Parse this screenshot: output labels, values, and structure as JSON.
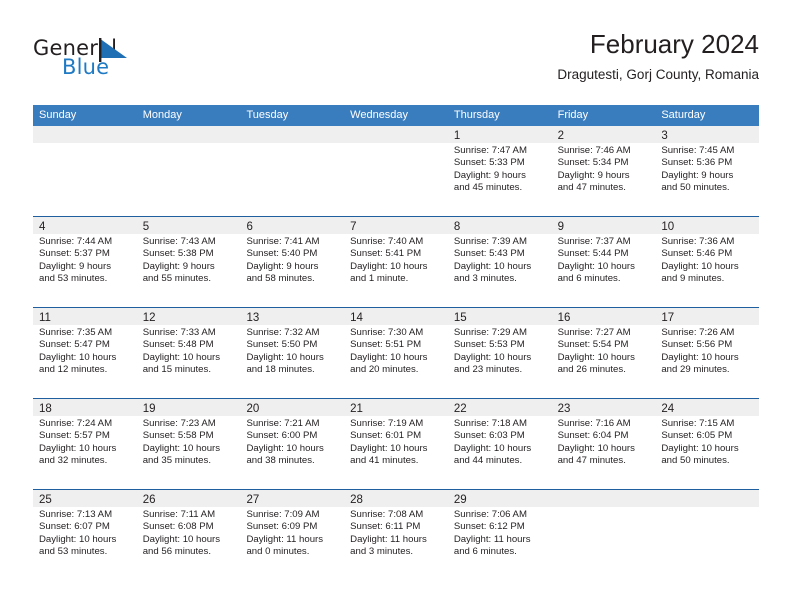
{
  "brand": {
    "word_general": "General",
    "word_blue": "Blue",
    "mark": "blue-flag-triangle"
  },
  "header": {
    "title": "February 2024",
    "location": "Dragutesti, Gorj County, Romania"
  },
  "colors": {
    "header_blue": "#3a7dbf",
    "row_divider_blue": "#1f5fa0",
    "day_band_gray": "#efefef",
    "brand_blue": "#1f7ac4",
    "text": "#231f20"
  },
  "weekdays": [
    "Sunday",
    "Monday",
    "Tuesday",
    "Wednesday",
    "Thursday",
    "Friday",
    "Saturday"
  ],
  "weeks": [
    [
      {
        "day": "",
        "sunrise": "",
        "sunset": "",
        "daylight_1": "",
        "daylight_2": ""
      },
      {
        "day": "",
        "sunrise": "",
        "sunset": "",
        "daylight_1": "",
        "daylight_2": ""
      },
      {
        "day": "",
        "sunrise": "",
        "sunset": "",
        "daylight_1": "",
        "daylight_2": ""
      },
      {
        "day": "",
        "sunrise": "",
        "sunset": "",
        "daylight_1": "",
        "daylight_2": ""
      },
      {
        "day": "1",
        "sunrise": "Sunrise: 7:47 AM",
        "sunset": "Sunset: 5:33 PM",
        "daylight_1": "Daylight: 9 hours",
        "daylight_2": "and 45 minutes."
      },
      {
        "day": "2",
        "sunrise": "Sunrise: 7:46 AM",
        "sunset": "Sunset: 5:34 PM",
        "daylight_1": "Daylight: 9 hours",
        "daylight_2": "and 47 minutes."
      },
      {
        "day": "3",
        "sunrise": "Sunrise: 7:45 AM",
        "sunset": "Sunset: 5:36 PM",
        "daylight_1": "Daylight: 9 hours",
        "daylight_2": "and 50 minutes."
      }
    ],
    [
      {
        "day": "4",
        "sunrise": "Sunrise: 7:44 AM",
        "sunset": "Sunset: 5:37 PM",
        "daylight_1": "Daylight: 9 hours",
        "daylight_2": "and 53 minutes."
      },
      {
        "day": "5",
        "sunrise": "Sunrise: 7:43 AM",
        "sunset": "Sunset: 5:38 PM",
        "daylight_1": "Daylight: 9 hours",
        "daylight_2": "and 55 minutes."
      },
      {
        "day": "6",
        "sunrise": "Sunrise: 7:41 AM",
        "sunset": "Sunset: 5:40 PM",
        "daylight_1": "Daylight: 9 hours",
        "daylight_2": "and 58 minutes."
      },
      {
        "day": "7",
        "sunrise": "Sunrise: 7:40 AM",
        "sunset": "Sunset: 5:41 PM",
        "daylight_1": "Daylight: 10 hours",
        "daylight_2": "and 1 minute."
      },
      {
        "day": "8",
        "sunrise": "Sunrise: 7:39 AM",
        "sunset": "Sunset: 5:43 PM",
        "daylight_1": "Daylight: 10 hours",
        "daylight_2": "and 3 minutes."
      },
      {
        "day": "9",
        "sunrise": "Sunrise: 7:37 AM",
        "sunset": "Sunset: 5:44 PM",
        "daylight_1": "Daylight: 10 hours",
        "daylight_2": "and 6 minutes."
      },
      {
        "day": "10",
        "sunrise": "Sunrise: 7:36 AM",
        "sunset": "Sunset: 5:46 PM",
        "daylight_1": "Daylight: 10 hours",
        "daylight_2": "and 9 minutes."
      }
    ],
    [
      {
        "day": "11",
        "sunrise": "Sunrise: 7:35 AM",
        "sunset": "Sunset: 5:47 PM",
        "daylight_1": "Daylight: 10 hours",
        "daylight_2": "and 12 minutes."
      },
      {
        "day": "12",
        "sunrise": "Sunrise: 7:33 AM",
        "sunset": "Sunset: 5:48 PM",
        "daylight_1": "Daylight: 10 hours",
        "daylight_2": "and 15 minutes."
      },
      {
        "day": "13",
        "sunrise": "Sunrise: 7:32 AM",
        "sunset": "Sunset: 5:50 PM",
        "daylight_1": "Daylight: 10 hours",
        "daylight_2": "and 18 minutes."
      },
      {
        "day": "14",
        "sunrise": "Sunrise: 7:30 AM",
        "sunset": "Sunset: 5:51 PM",
        "daylight_1": "Daylight: 10 hours",
        "daylight_2": "and 20 minutes."
      },
      {
        "day": "15",
        "sunrise": "Sunrise: 7:29 AM",
        "sunset": "Sunset: 5:53 PM",
        "daylight_1": "Daylight: 10 hours",
        "daylight_2": "and 23 minutes."
      },
      {
        "day": "16",
        "sunrise": "Sunrise: 7:27 AM",
        "sunset": "Sunset: 5:54 PM",
        "daylight_1": "Daylight: 10 hours",
        "daylight_2": "and 26 minutes."
      },
      {
        "day": "17",
        "sunrise": "Sunrise: 7:26 AM",
        "sunset": "Sunset: 5:56 PM",
        "daylight_1": "Daylight: 10 hours",
        "daylight_2": "and 29 minutes."
      }
    ],
    [
      {
        "day": "18",
        "sunrise": "Sunrise: 7:24 AM",
        "sunset": "Sunset: 5:57 PM",
        "daylight_1": "Daylight: 10 hours",
        "daylight_2": "and 32 minutes."
      },
      {
        "day": "19",
        "sunrise": "Sunrise: 7:23 AM",
        "sunset": "Sunset: 5:58 PM",
        "daylight_1": "Daylight: 10 hours",
        "daylight_2": "and 35 minutes."
      },
      {
        "day": "20",
        "sunrise": "Sunrise: 7:21 AM",
        "sunset": "Sunset: 6:00 PM",
        "daylight_1": "Daylight: 10 hours",
        "daylight_2": "and 38 minutes."
      },
      {
        "day": "21",
        "sunrise": "Sunrise: 7:19 AM",
        "sunset": "Sunset: 6:01 PM",
        "daylight_1": "Daylight: 10 hours",
        "daylight_2": "and 41 minutes."
      },
      {
        "day": "22",
        "sunrise": "Sunrise: 7:18 AM",
        "sunset": "Sunset: 6:03 PM",
        "daylight_1": "Daylight: 10 hours",
        "daylight_2": "and 44 minutes."
      },
      {
        "day": "23",
        "sunrise": "Sunrise: 7:16 AM",
        "sunset": "Sunset: 6:04 PM",
        "daylight_1": "Daylight: 10 hours",
        "daylight_2": "and 47 minutes."
      },
      {
        "day": "24",
        "sunrise": "Sunrise: 7:15 AM",
        "sunset": "Sunset: 6:05 PM",
        "daylight_1": "Daylight: 10 hours",
        "daylight_2": "and 50 minutes."
      }
    ],
    [
      {
        "day": "25",
        "sunrise": "Sunrise: 7:13 AM",
        "sunset": "Sunset: 6:07 PM",
        "daylight_1": "Daylight: 10 hours",
        "daylight_2": "and 53 minutes."
      },
      {
        "day": "26",
        "sunrise": "Sunrise: 7:11 AM",
        "sunset": "Sunset: 6:08 PM",
        "daylight_1": "Daylight: 10 hours",
        "daylight_2": "and 56 minutes."
      },
      {
        "day": "27",
        "sunrise": "Sunrise: 7:09 AM",
        "sunset": "Sunset: 6:09 PM",
        "daylight_1": "Daylight: 11 hours",
        "daylight_2": "and 0 minutes."
      },
      {
        "day": "28",
        "sunrise": "Sunrise: 7:08 AM",
        "sunset": "Sunset: 6:11 PM",
        "daylight_1": "Daylight: 11 hours",
        "daylight_2": "and 3 minutes."
      },
      {
        "day": "29",
        "sunrise": "Sunrise: 7:06 AM",
        "sunset": "Sunset: 6:12 PM",
        "daylight_1": "Daylight: 11 hours",
        "daylight_2": "and 6 minutes."
      },
      {
        "day": "",
        "sunrise": "",
        "sunset": "",
        "daylight_1": "",
        "daylight_2": ""
      },
      {
        "day": "",
        "sunrise": "",
        "sunset": "",
        "daylight_1": "",
        "daylight_2": ""
      }
    ]
  ]
}
